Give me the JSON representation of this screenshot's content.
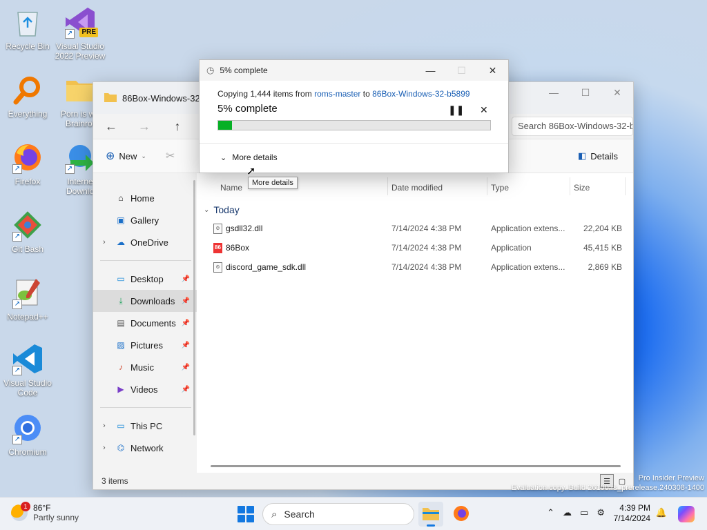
{
  "desktop": {
    "icons": [
      {
        "label": "Recycle Bin",
        "icon": "recycle-bin-icon"
      },
      {
        "label": "Visual Studio 2022 Preview",
        "icon": "visual-studio-icon",
        "badge": "PRE"
      },
      {
        "label": "Everything",
        "icon": "search-magnifier-icon"
      },
      {
        "label": "Porn is wo Brainrot",
        "icon": "folder-icon"
      },
      {
        "label": "Firefox",
        "icon": "firefox-icon"
      },
      {
        "label": "Interne Downlo",
        "icon": "internet-download-manager-icon"
      },
      {
        "label": "Git Bash",
        "icon": "git-bash-icon"
      },
      {
        "label": "Notepad++",
        "icon": "notepadpp-icon"
      },
      {
        "label": "Visual Studio Code",
        "icon": "vscode-icon"
      },
      {
        "label": "Chromium",
        "icon": "chromium-icon"
      }
    ],
    "watermark": {
      "line1": "Pro Insider Preview",
      "line2": "Evaluation copy. Build 26100.rs_prerelease.240308-1400"
    }
  },
  "explorer": {
    "tab_title": "86Box-Windows-32-",
    "search_placeholder": "Search 86Box-Windows-32-b",
    "toolbar": {
      "new_label": "New",
      "details_label": "Details"
    },
    "sidebar": {
      "quick": [
        {
          "label": "Home",
          "icon": "home-icon"
        },
        {
          "label": "Gallery",
          "icon": "gallery-icon"
        },
        {
          "label": "OneDrive",
          "icon": "onedrive-icon",
          "expandable": true
        }
      ],
      "pinned": [
        {
          "label": "Desktop",
          "icon": "desktop-folder-icon"
        },
        {
          "label": "Downloads",
          "icon": "downloads-icon",
          "selected": true
        },
        {
          "label": "Documents",
          "icon": "documents-icon"
        },
        {
          "label": "Pictures",
          "icon": "pictures-icon"
        },
        {
          "label": "Music",
          "icon": "music-icon"
        },
        {
          "label": "Videos",
          "icon": "videos-icon"
        }
      ],
      "devices": [
        {
          "label": "This PC",
          "icon": "this-pc-icon"
        },
        {
          "label": "Network",
          "icon": "network-icon"
        }
      ]
    },
    "columns": {
      "name": "Name",
      "date": "Date modified",
      "type": "Type",
      "size": "Size"
    },
    "group": "Today",
    "files": [
      {
        "name": "gsdll32.dll",
        "date": "7/14/2024 4:38 PM",
        "type": "Application extens...",
        "size": "22,204 KB",
        "icon": "dll-file-icon"
      },
      {
        "name": "86Box",
        "date": "7/14/2024 4:38 PM",
        "type": "Application",
        "size": "45,415 KB",
        "icon": "app-86box-icon"
      },
      {
        "name": "discord_game_sdk.dll",
        "date": "7/14/2024 4:38 PM",
        "type": "Application extens...",
        "size": "2,869 KB",
        "icon": "dll-file-icon"
      }
    ],
    "status": "3 items"
  },
  "copy_dialog": {
    "title": "5% complete",
    "copying_prefix": "Copying 1,444 items from",
    "source": "roms-master",
    "to": "to",
    "destination": "86Box-Windows-32-b5899",
    "percent_label": "5% complete",
    "progress": 0.05,
    "more_details": "More details",
    "tooltip": "More details",
    "progress_color": "#06b025"
  },
  "taskbar": {
    "weather": {
      "temp": "86°F",
      "desc": "Partly sunny",
      "badge": "1"
    },
    "search_placeholder": "Search",
    "time": "4:39 PM",
    "date": "7/14/2024"
  }
}
